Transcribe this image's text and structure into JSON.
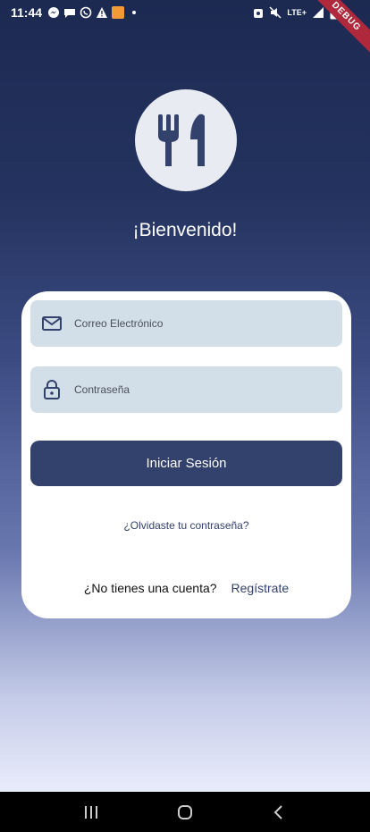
{
  "status_bar": {
    "time": "11:44",
    "network": "LTE+",
    "debug_label": "DEBUG",
    "left_icons": [
      "messenger-icon",
      "chat-icon",
      "whatsapp-icon",
      "warning-icon",
      "app-icon",
      "dot-icon"
    ],
    "right_icons": [
      "alarm-icon",
      "mute-icon",
      "signal-icon",
      "battery-icon"
    ]
  },
  "app": {
    "logo_icon": "utensils-icon",
    "welcome": "¡Bienvenido!"
  },
  "login_form": {
    "email_placeholder": "Correo Electrónico",
    "email_value": "",
    "password_placeholder": "Contraseña",
    "password_value": "",
    "login_button": "Iniciar Sesión",
    "forgot_password": "¿Olvidaste tu contraseña?",
    "no_account": "¿No tienes una cuenta?",
    "register": "Regístrate"
  },
  "colors": {
    "primary": "#33416d",
    "field_bg": "#d3dfe8",
    "logo_bg": "#e9ebf2"
  },
  "nav_bar": {
    "icons": [
      "recent-apps-icon",
      "home-icon",
      "back-icon"
    ]
  }
}
